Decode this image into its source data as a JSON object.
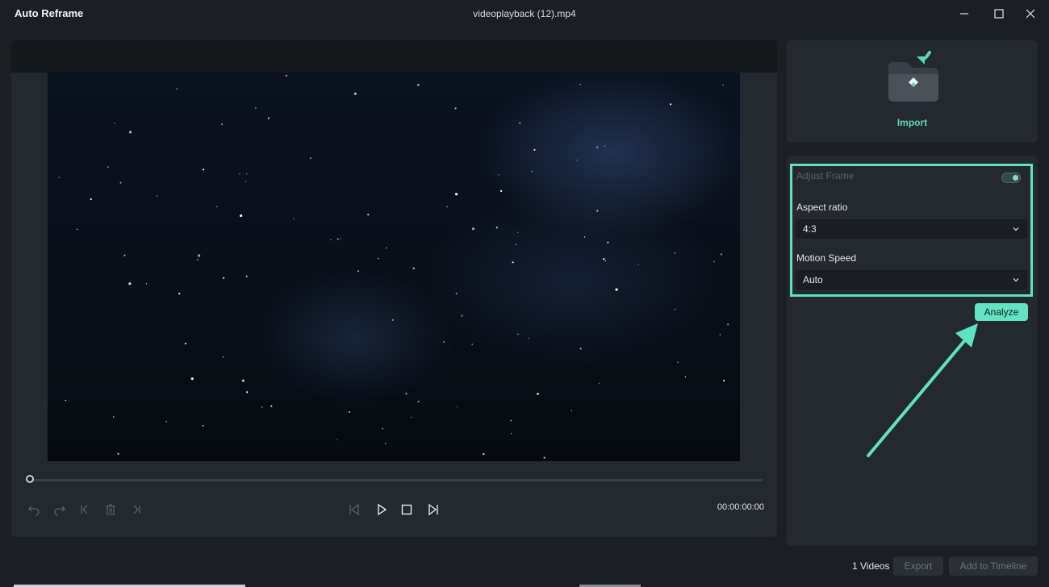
{
  "window": {
    "app_title": "Auto Reframe",
    "file_name": "videoplayback (12).mp4",
    "minimize_icon": "minimize-icon",
    "maximize_icon": "maximize-icon",
    "close_icon": "close-icon"
  },
  "player": {
    "timecode": "00:00:00:00",
    "progress_fraction": 0,
    "controls": [
      "undo-icon",
      "redo-icon",
      "previous-clip-icon",
      "delete-icon",
      "next-clip-icon",
      "previous-frame-icon",
      "play-icon",
      "stop-icon",
      "next-frame-icon"
    ]
  },
  "import": {
    "label": "Import",
    "icon": "import-folder-icon"
  },
  "settings": {
    "adjust_frame_label": "Adjust Frame",
    "adjust_frame_on": true,
    "aspect_ratio_label": "Aspect ratio",
    "aspect_ratio_value": "4:3",
    "motion_speed_label": "Motion Speed",
    "motion_speed_value": "Auto",
    "analyze_label": "Analyze"
  },
  "footer": {
    "videos_count": "1 Videos",
    "export_label": "Export",
    "add_to_timeline_label": "Add to Timeline"
  },
  "colors": {
    "accent": "#62e3c1",
    "highlight": "#5ee3c2",
    "panel": "#24282f",
    "background": "#1b1e23"
  }
}
